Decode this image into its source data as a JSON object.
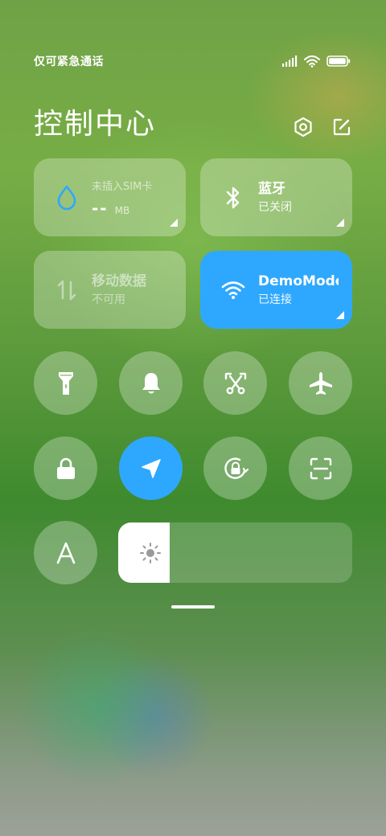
{
  "status_bar": {
    "carrier": "仅可紧急通话",
    "signal_icon": "signal-icon",
    "wifi_icon": "wifi-icon",
    "battery_icon": "battery-icon"
  },
  "header": {
    "title": "控制中心",
    "settings_icon": "settings-icon",
    "edit_icon": "edit-icon"
  },
  "tiles": {
    "data_usage": {
      "label": "未插入SIM卡",
      "value": "--",
      "unit": "MB",
      "icon": "water-drop-icon"
    },
    "bluetooth": {
      "label": "蓝牙",
      "status": "已关闭",
      "icon": "bluetooth-icon"
    },
    "mobile_data": {
      "label": "移动数据",
      "status": "不可用",
      "icon": "mobile-data-icon"
    },
    "wifi": {
      "label": "DemoMode",
      "status": "已连接",
      "icon": "wifi-icon"
    }
  },
  "toggles": [
    {
      "name": "flashlight",
      "icon": "flashlight-icon",
      "active": false
    },
    {
      "name": "notifications",
      "icon": "bell-icon",
      "active": false
    },
    {
      "name": "screenshot",
      "icon": "scissors-icon",
      "active": false
    },
    {
      "name": "airplane-mode",
      "icon": "airplane-icon",
      "active": false
    },
    {
      "name": "lock-screen",
      "icon": "lock-icon",
      "active": false
    },
    {
      "name": "location",
      "icon": "location-arrow-icon",
      "active": true
    },
    {
      "name": "rotation-lock",
      "icon": "rotation-lock-icon",
      "active": false
    },
    {
      "name": "scanner",
      "icon": "scan-icon",
      "active": false
    },
    {
      "name": "auto-font",
      "icon": "font-a-icon",
      "active": false
    }
  ],
  "brightness": {
    "level": 0.22,
    "icon": "sun-icon"
  },
  "colors": {
    "accent": "#2ea8ff",
    "tile_bg": "rgba(255,255,255,0.28)"
  }
}
